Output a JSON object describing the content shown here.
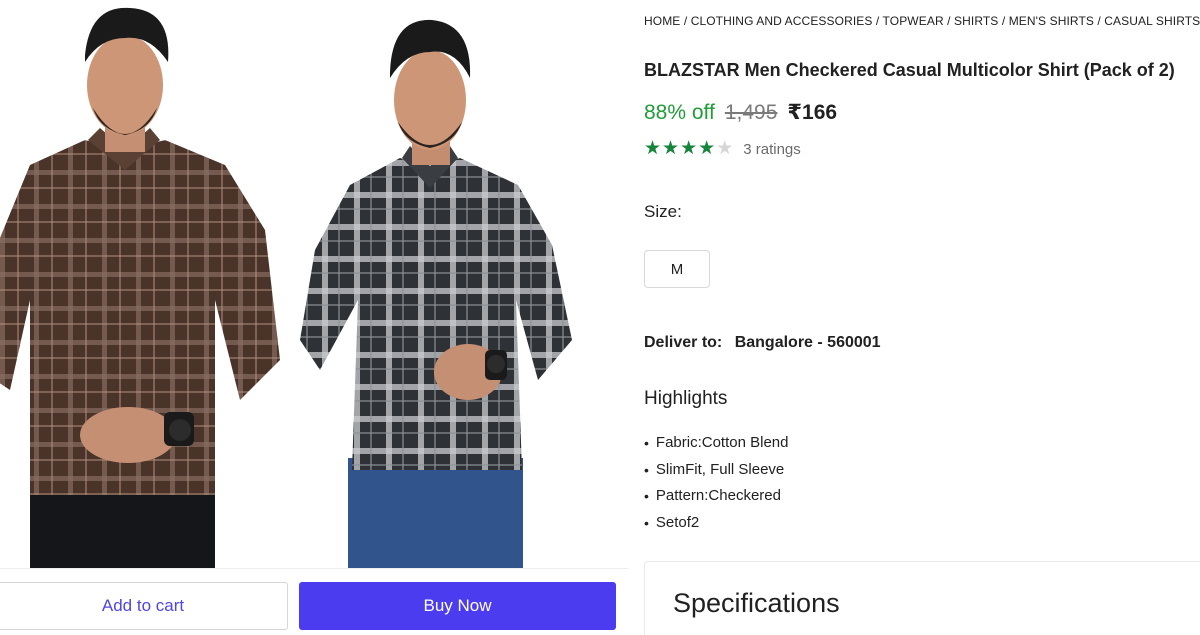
{
  "gallery": {
    "images": [
      {
        "alt": "Model in brown checkered shirt"
      },
      {
        "alt": "Model in black and white checkered shirt"
      }
    ]
  },
  "actions": {
    "add_to_cart": "Add to cart",
    "buy_now": "Buy Now"
  },
  "breadcrumb": "HOME / CLOTHING AND ACCESSORIES / TOPWEAR / SHIRTS / MEN'S SHIRTS / CASUAL SHIRTS / BL",
  "product": {
    "title": "BLAZSTAR Men Checkered Casual Multicolor Shirt (Pack of 2)",
    "discount": "88% off",
    "mrp": "1,495",
    "price": "₹166",
    "rating_stars": 4,
    "rating_max": 5,
    "rating_count": "3 ratings"
  },
  "size": {
    "label": "Size:",
    "selected": "M"
  },
  "delivery": {
    "label": "Deliver to:",
    "location": "Bangalore - 560001"
  },
  "highlights": {
    "title": "Highlights",
    "items": [
      "Fabric:Cotton Blend",
      "SlimFit, Full Sleeve",
      "Pattern:Checkered",
      "Setof2"
    ]
  },
  "specifications": {
    "title": "Specifications"
  },
  "colors": {
    "accent": "#4b3cf0",
    "discount": "#1f9d38",
    "star": "#14853b"
  }
}
